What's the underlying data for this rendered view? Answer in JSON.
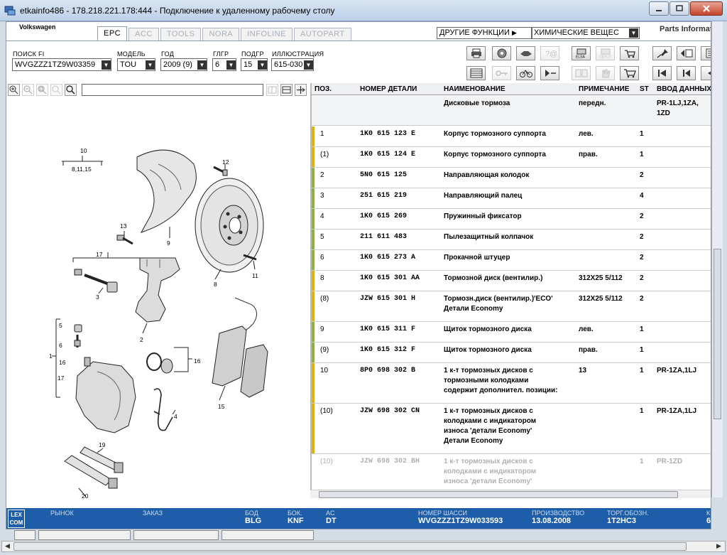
{
  "window": {
    "title": "etkainfo486 - 178.218.221.178:444 - Подключение к удаленному рабочему столу"
  },
  "app": {
    "brand": "Volkswagen",
    "parts_info": "Parts Informat",
    "tabs": [
      {
        "label": "EPC",
        "active": true
      },
      {
        "label": "ACC",
        "active": false
      },
      {
        "label": "TOOLS",
        "active": false
      },
      {
        "label": "NORA",
        "active": false
      },
      {
        "label": "INFOLINE",
        "active": false
      },
      {
        "label": "AUTOPART",
        "active": false
      }
    ],
    "other_functions": "ДРУГИЕ ФУНКЦИИ",
    "chemical": "ХИМИЧЕСКИЕ ВЕЩЕС"
  },
  "filters": {
    "vin_label": "ПОИСК FI",
    "vin_value": "WVGZZZ1TZ9W03359",
    "model_label": "МОДЕЛЬ",
    "model_value": "TOU",
    "year_label": "ГОД",
    "year_value": "2009 (9)",
    "mg_label": "ГЛГР",
    "mg_value": "6",
    "sg_label": "ПОДГР",
    "sg_value": "15",
    "illus_label": "ИЛЛЮСТРАЦИЯ",
    "illus_value": "615-030"
  },
  "table": {
    "headers": {
      "pos": "ПОЗ.",
      "part_no": "НОМЕР ДЕТАЛИ",
      "name": "НАИМЕНОВАНИЕ",
      "note": "ПРИМЕЧАНИЕ",
      "st": "ST",
      "input": "ВВОД ДАННЫХ"
    },
    "group_row": {
      "name": "Дисковые тормоза",
      "note": "передн.",
      "input": "PR-1LJ,1ZA,\n1ZD"
    },
    "rows": [
      {
        "pos": "1",
        "part_no": "1K0 615 123 E",
        "name": "Корпус тормозного суппорта",
        "note": "лев.",
        "st": "1",
        "input": "",
        "mark": "#e3b20a"
      },
      {
        "pos": "(1)",
        "part_no": "1K0 615 124 E",
        "name": "Корпус тормозного суппорта",
        "note": "прав.",
        "st": "1",
        "input": "",
        "mark": "#e3b20a"
      },
      {
        "pos": "2",
        "part_no": "5N0 615 125",
        "name": "Направляющая колодок",
        "note": "",
        "st": "2",
        "input": "",
        "mark": "#8db33c"
      },
      {
        "pos": "3",
        "part_no": "251 615 219",
        "name": "Направляющий палец",
        "note": "",
        "st": "4",
        "input": "",
        "mark": "#8db33c"
      },
      {
        "pos": "4",
        "part_no": "1K0 615 269",
        "name": "Пружинный фиксатор",
        "note": "",
        "st": "2",
        "input": "",
        "mark": "#8db33c"
      },
      {
        "pos": "5",
        "part_no": "211 611 483",
        "name": "Пылезащитный колпачок",
        "note": "",
        "st": "2",
        "input": "",
        "mark": "#8db33c"
      },
      {
        "pos": "6",
        "part_no": "1K0 615 273 A",
        "name": "Прокачной штуцер",
        "note": "",
        "st": "2",
        "input": "",
        "mark": "#8db33c"
      },
      {
        "pos": "8",
        "part_no": "1K0 615 301 AA",
        "name": "Тормозной диск (вентилир.)",
        "note": "312X25  5/112",
        "st": "2",
        "input": "",
        "mark": "#e3b20a"
      },
      {
        "pos": "(8)",
        "part_no": "JZW 615 301 H",
        "name": "Тормозн.диск (вентилир.)'ECO'\nДетали Economy",
        "note": "312X25  5/112",
        "st": "2",
        "input": "",
        "mark": "#e3b20a"
      },
      {
        "pos": "9",
        "part_no": "1K0 615 311 F",
        "name": "Щиток тормозного диска",
        "note": "лев.",
        "st": "1",
        "input": "",
        "mark": "#8db33c"
      },
      {
        "pos": "(9)",
        "part_no": "1K0 615 312 F",
        "name": "Щиток тормозного диска",
        "note": "прав.",
        "st": "1",
        "input": "",
        "mark": "#8db33c"
      },
      {
        "pos": "10",
        "part_no": "8P0 698 302 B",
        "name": "1 к-т тормозных дисков с\nтормозными колодками\n содержит дополнител. позиции:",
        "note": "13",
        "st": "1",
        "input": "PR-1ZA,1LJ",
        "mark": "#e3b20a"
      },
      {
        "pos": "(10)",
        "part_no": "JZW 698 302 CN",
        "name": "1 к-т тормозных дисков с\nколодками с индикатором\nизноса      'детали Economy'\nДетали Economy",
        "note": "",
        "st": "1",
        "input": "PR-1ZA,1LJ",
        "mark": "#e3b20a"
      },
      {
        "pos": "(10)",
        "part_no": "JZW 698 302 BH",
        "name": "1 к-т тормозных дисков с\nколодками с индикатором\nизноса      'детали Economy'",
        "note": "",
        "st": "1",
        "input": "PR-1ZD",
        "mark": "",
        "dim": true
      }
    ]
  },
  "illustration": {
    "callouts": [
      "10",
      "8,11,15",
      "12",
      "13",
      "17",
      "3",
      "9",
      "8",
      "11",
      "2",
      "5",
      "1",
      "16",
      "6",
      "16",
      "17",
      "4",
      "15",
      "19",
      "20"
    ]
  },
  "status": {
    "logo": "LEX\nCOM",
    "market_label": "РЫНОК",
    "order_label": "ЗАКАЗ",
    "bod_label": "БОД",
    "bod_value": "BLG",
    "bok_label": "БОК.",
    "bok_value": "KNF",
    "ac_label": "AC",
    "ac_value": "DT",
    "chassis_label": "НОМЕР ШАССИ",
    "chassis_value": "WVGZZZ1TZ9W033593",
    "prod_label": "ПРОИЗВОДСТВО",
    "prod_value": "13.08.2008",
    "trade_label": "ТОРГ.ОБОЗН.",
    "trade_value": "1T2HC3",
    "extra_label": "К",
    "extra_value": "6"
  },
  "colors": {
    "status_bar": "#1e5ea8",
    "mark_yellow": "#e3b20a",
    "mark_green": "#8db33c"
  }
}
